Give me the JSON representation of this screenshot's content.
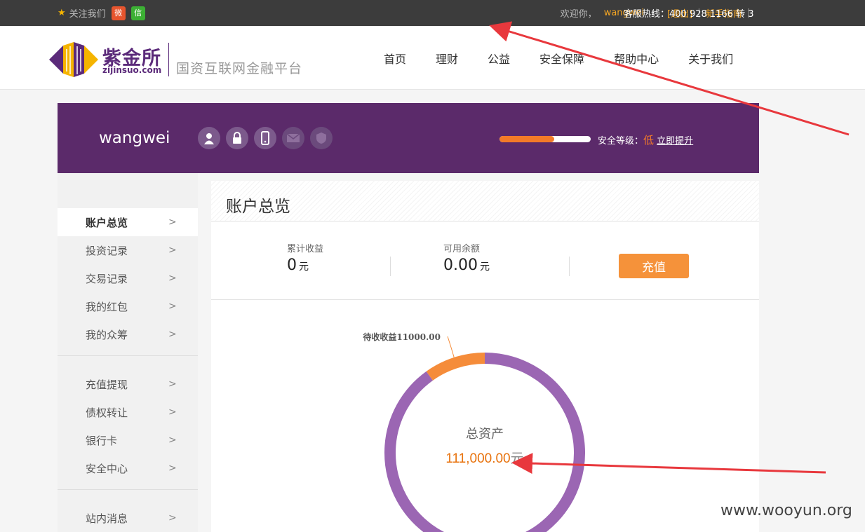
{
  "topbar": {
    "follow_label": "关注我们",
    "welcome": "欢迎你，",
    "username": "wangwei",
    "exclaim": "！",
    "logout": "[退出]",
    "guide": "新手指南",
    "hotline": "客服热线：400 928 1166 转 3"
  },
  "header": {
    "logo_cn": "紫金所",
    "logo_en": "zijinsuo.com",
    "slogan": "国资互联网金融平台",
    "nav": [
      "首页",
      "理财",
      "公益",
      "安全保障",
      "帮助中心",
      "关于我们"
    ]
  },
  "banner": {
    "username": "wangwei",
    "security_label": "安全等级：",
    "security_level": "低",
    "upgrade": "立即提升",
    "security_progress": 0.6,
    "badges": [
      "avatar-badge-icon",
      "lock-badge-icon",
      "phone-badge-icon",
      "mail-badge-icon",
      "shield-badge-icon"
    ]
  },
  "sidebar": {
    "items": [
      "账户总览",
      "投资记录",
      "交易记录",
      "我的红包",
      "我的众筹",
      "充值提现",
      "债权转让",
      "银行卡",
      "安全中心",
      "站内消息"
    ],
    "active": "账户总览"
  },
  "main": {
    "title": "账户总览",
    "stats": [
      {
        "label": "累计收益",
        "value": "0",
        "unit": "元"
      },
      {
        "label": "可用余额",
        "value": "0.00",
        "unit": "元"
      }
    ],
    "recharge": "充值"
  },
  "chart_data": {
    "type": "pie",
    "center_label": "总资产",
    "total": "111,000.00",
    "total_unit": "元",
    "slice_label": "待收收益11000.00",
    "slices": [
      {
        "name": "待收收益",
        "value": 11000,
        "color": "#f58c3a"
      },
      {
        "name": "",
        "value": 100000,
        "color": "#9b66b3"
      }
    ]
  },
  "watermark": "www.wooyun.org",
  "colors": {
    "purple": "#5b2a6a",
    "orange": "#f5923a",
    "ring_purple": "#9b66b3",
    "arrow": "#e8383d"
  }
}
